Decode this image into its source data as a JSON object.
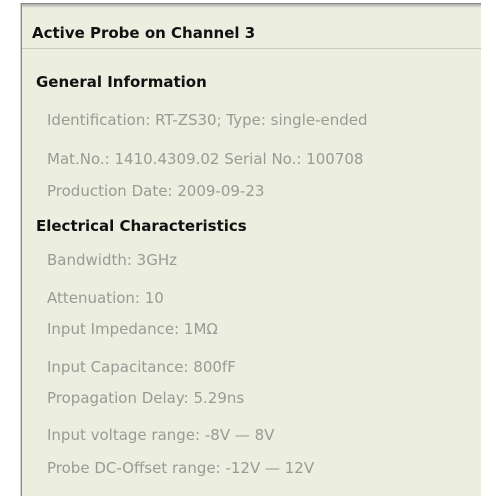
{
  "dialog": {
    "title": "Active Probe on Channel 3"
  },
  "general": {
    "heading": "General Information",
    "identification": "Identification: RT-ZS30; Type: single-ended",
    "matno": "Mat.No.: 1410.4309.02  Serial No.: 100708",
    "production_date": "Production Date: 2009-09-23"
  },
  "electrical": {
    "heading": "Electrical Characteristics",
    "bandwidth": "Bandwidth: 3GHz",
    "attenuation": "Attenuation: 10",
    "input_impedance": "Input Impedance: 1MΩ",
    "input_capacitance": "Input Capacitance: 800fF",
    "propagation_delay": "Propagation Delay: 5.29ns",
    "input_voltage_range": "Input voltage range: -8V — 8V",
    "offset_range": "Probe DC-Offset range: -12V — 12V"
  }
}
